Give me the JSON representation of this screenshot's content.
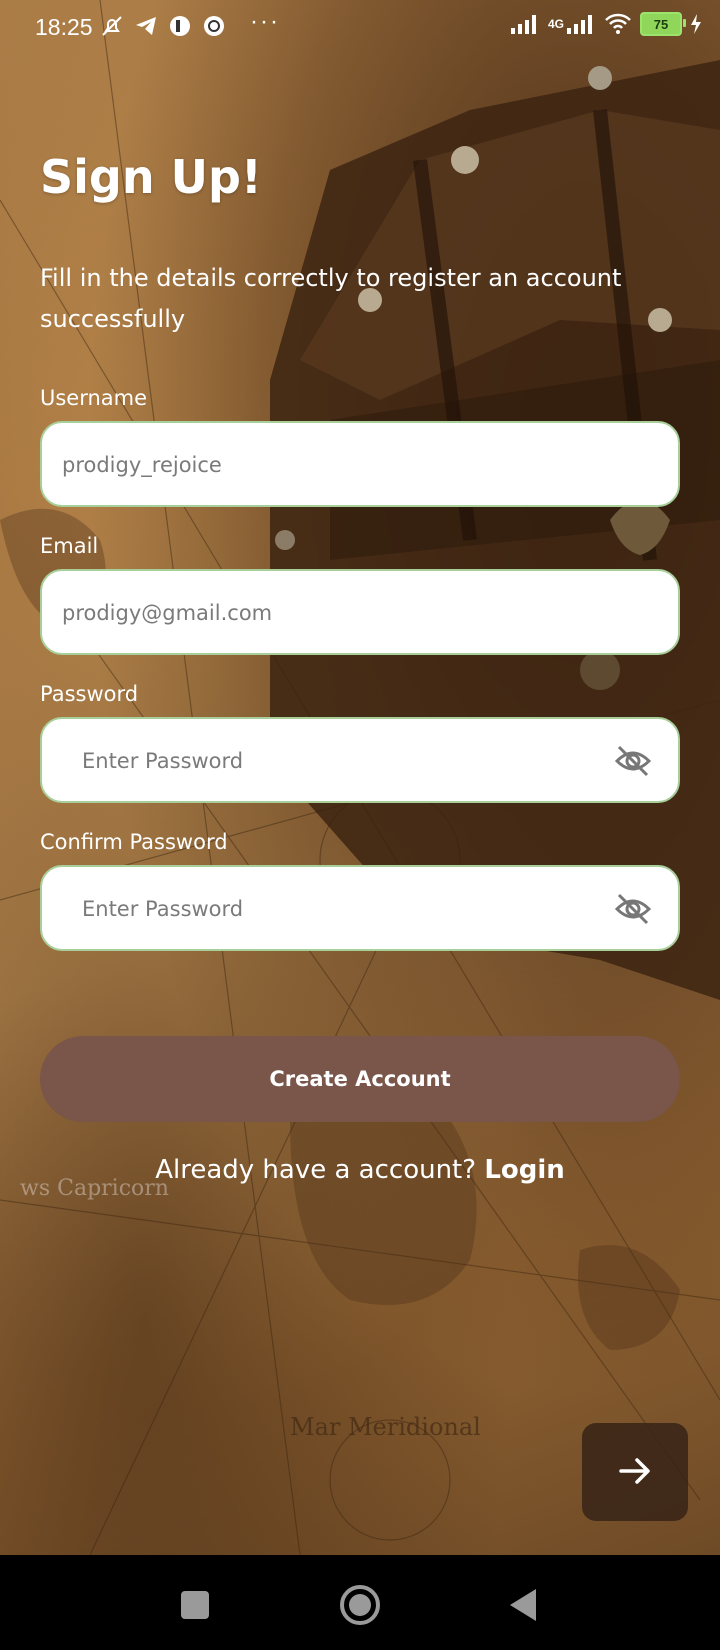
{
  "status_bar": {
    "time": "18:25",
    "more": "···",
    "network": "4G",
    "battery": "75",
    "icons": [
      "muted-notification-icon",
      "telegram-icon",
      "app-icon",
      "app-icon",
      "signal-icon",
      "wifi-icon",
      "battery-icon",
      "charging-icon"
    ]
  },
  "page": {
    "title": "Sign Up!",
    "subtitle": "Fill in the details correctly to register an account successfully"
  },
  "form": {
    "username": {
      "label": "Username",
      "placeholder": "prodigy_rejoice"
    },
    "email": {
      "label": "Email",
      "placeholder": "prodigy@gmail.com"
    },
    "password": {
      "label": "Password",
      "placeholder": "Enter Password",
      "toggle_icon": "eye-off-icon"
    },
    "confirm_password": {
      "label": "Confirm Password",
      "placeholder": "Enter Password",
      "toggle_icon": "eye-off-icon"
    },
    "submit_label": "Create Account"
  },
  "login_prompt": {
    "text": "Already have a account?",
    "link": "Login"
  },
  "fab": {
    "icon": "arrow-right-icon"
  },
  "nav_bar": {
    "buttons": [
      "recents-icon",
      "home-icon",
      "back-icon"
    ]
  },
  "colors": {
    "button": "#79554a",
    "field_border": "#a8cf9a",
    "battery": "#8fd65b"
  }
}
